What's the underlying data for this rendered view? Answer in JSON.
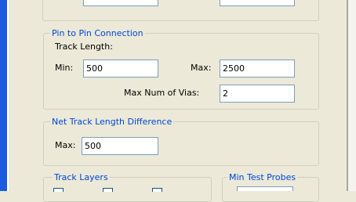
{
  "pin_to_pin": {
    "legend": "Pin to Pin Connection",
    "track_length_label": "Track Length:",
    "min_label": "Min:",
    "min_value": "500",
    "max_label": "Max:",
    "max_value": "2500",
    "max_vias_label": "Max Num of Vias:",
    "max_vias_value": "2"
  },
  "net_track": {
    "legend": "Net Track Length Difference",
    "max_label": "Max:",
    "max_value": "500"
  },
  "track_layers": {
    "legend": "Track Layers"
  },
  "min_test_probes": {
    "legend": "Min Test Probes"
  }
}
